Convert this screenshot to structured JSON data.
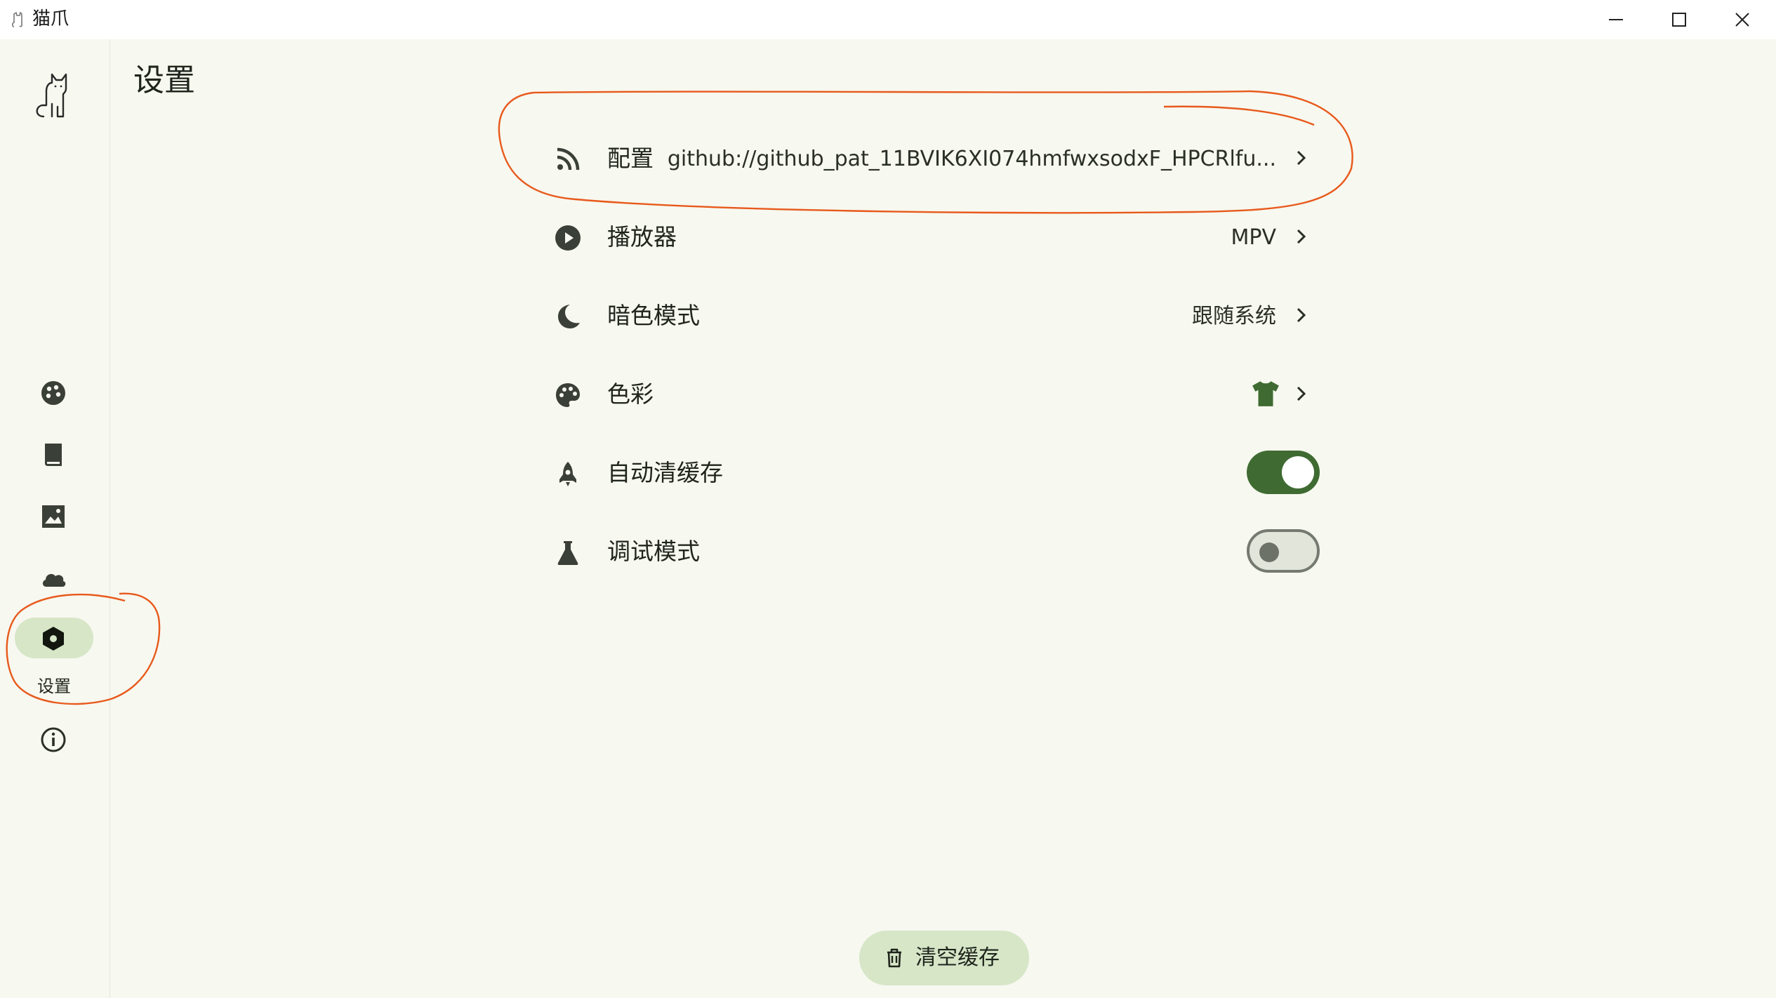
{
  "window": {
    "title": "猫爪",
    "controls": [
      "minimize-icon",
      "maximize-icon",
      "close-icon"
    ]
  },
  "sidebar": {
    "items": [
      {
        "icon": "palette-dots-icon",
        "label": ""
      },
      {
        "icon": "book-icon",
        "label": ""
      },
      {
        "icon": "image-icon",
        "label": ""
      },
      {
        "icon": "cloud-icon",
        "label": ""
      },
      {
        "icon": "hexagon-settings-icon",
        "label": "设置",
        "active": true
      },
      {
        "icon": "info-icon",
        "label": ""
      }
    ]
  },
  "page": {
    "title": "设置"
  },
  "settings": [
    {
      "icon": "rss-icon",
      "label": "配置",
      "value": "github://github_pat_11BVIK6XI074hmfwxsodxF_HPCRlfu..."
    },
    {
      "icon": "play-icon",
      "label": "播放器",
      "value": "MPV"
    },
    {
      "icon": "moon-icon",
      "label": "暗色模式",
      "value": "跟随系统"
    },
    {
      "icon": "palette-icon",
      "label": "色彩",
      "value_icon": "tshirt-icon"
    },
    {
      "icon": "rocket-icon",
      "label": "自动清缓存",
      "toggle": true
    },
    {
      "icon": "flask-icon",
      "label": "调试模式",
      "toggle": false
    }
  ],
  "actions": {
    "clear_cache_label": "清空缓存"
  },
  "colors": {
    "background": "#f7f8ef",
    "accent": "#3f6b32",
    "pill": "#d6e6c7",
    "annotation": "#e8591c"
  }
}
